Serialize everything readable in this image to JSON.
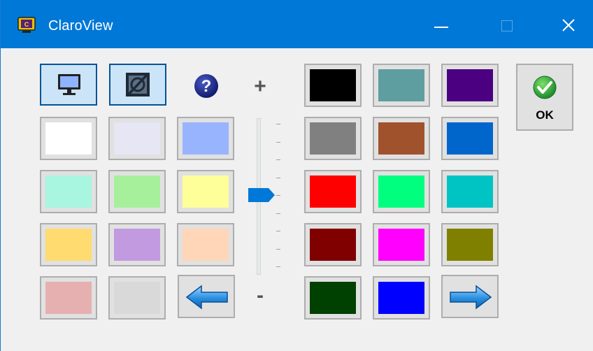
{
  "window": {
    "title": "ClaroView",
    "titlebar_color": "#0078d7",
    "controls": [
      "minimize-icon",
      "maximize-icon",
      "close-icon"
    ]
  },
  "toolbar": {
    "monitor_button": {
      "icon": "monitor-icon",
      "state": "pressed"
    },
    "no_filter_button": {
      "icon": "no-filter-icon",
      "state": "pressed"
    },
    "help_button": {
      "icon": "help-icon",
      "symbol": "?"
    }
  },
  "slider": {
    "plus_label": "+",
    "minus_label": "-",
    "ticks": 9,
    "level": 0.5
  },
  "swatches_left": [
    [
      "#ffffff",
      "#e6e6f5",
      "#99b4ff"
    ],
    [
      "#a8f5e0",
      "#a6f09c",
      "#ffff99"
    ],
    [
      "#ffdb70",
      "#c19ae0",
      "#ffd6b8"
    ],
    [
      "#e6b0b0",
      "#d9d9d9"
    ]
  ],
  "swatches_right": [
    [
      "#000000",
      "#5f9ea0",
      "#4b0082"
    ],
    [
      "#808080",
      "#a0522d",
      "#0066cc"
    ],
    [
      "#ff0000",
      "#00ff7f",
      "#00c4c4"
    ],
    [
      "#800000",
      "#ff00ff",
      "#808000"
    ],
    [
      "#004000",
      "#0000ff"
    ]
  ],
  "nav": {
    "back_icon": "arrow-left-icon",
    "forward_icon": "arrow-right-icon"
  },
  "ok_button": {
    "label": "OK",
    "icon": "check-icon"
  }
}
